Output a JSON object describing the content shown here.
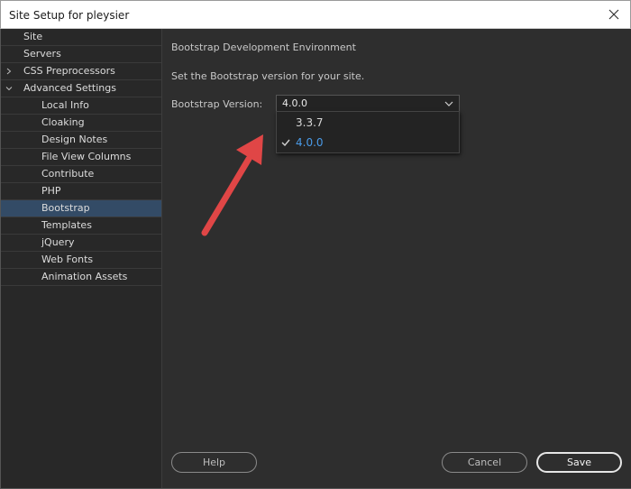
{
  "window": {
    "title": "Site Setup for pleysier"
  },
  "sidebar": {
    "items": [
      {
        "label": "Site",
        "level": 0,
        "chevron": ""
      },
      {
        "label": "Servers",
        "level": 0,
        "chevron": ""
      },
      {
        "label": "CSS Preprocessors",
        "level": 0,
        "chevron": "right"
      },
      {
        "label": "Advanced Settings",
        "level": 0,
        "chevron": "down"
      },
      {
        "label": "Local Info",
        "level": 1
      },
      {
        "label": "Cloaking",
        "level": 1
      },
      {
        "label": "Design Notes",
        "level": 1
      },
      {
        "label": "File View Columns",
        "level": 1
      },
      {
        "label": "Contribute",
        "level": 1
      },
      {
        "label": "PHP",
        "level": 1
      },
      {
        "label": "Bootstrap",
        "level": 1,
        "selected": true
      },
      {
        "label": "Templates",
        "level": 1
      },
      {
        "label": "jQuery",
        "level": 1
      },
      {
        "label": "Web Fonts",
        "level": 1
      },
      {
        "label": "Animation Assets",
        "level": 1
      }
    ]
  },
  "main": {
    "heading": "Bootstrap Development Environment",
    "description": "Set the Bootstrap version for your site.",
    "version_label": "Bootstrap Version:",
    "version_select": {
      "value": "4.0.0",
      "options": [
        {
          "label": "3.3.7",
          "checked": false
        },
        {
          "label": "4.0.0",
          "checked": true
        }
      ]
    }
  },
  "buttons": {
    "help": "Help",
    "cancel": "Cancel",
    "save": "Save"
  },
  "colors": {
    "selected_bg": "#334b66",
    "accent_text": "#4a9be8",
    "annotation_arrow": "#e04646"
  },
  "icons": {
    "close": "close-icon",
    "checkmark": "checkmark-icon",
    "dropdown": "chevron-down-icon",
    "annotation": "red-arrow-annotation"
  }
}
